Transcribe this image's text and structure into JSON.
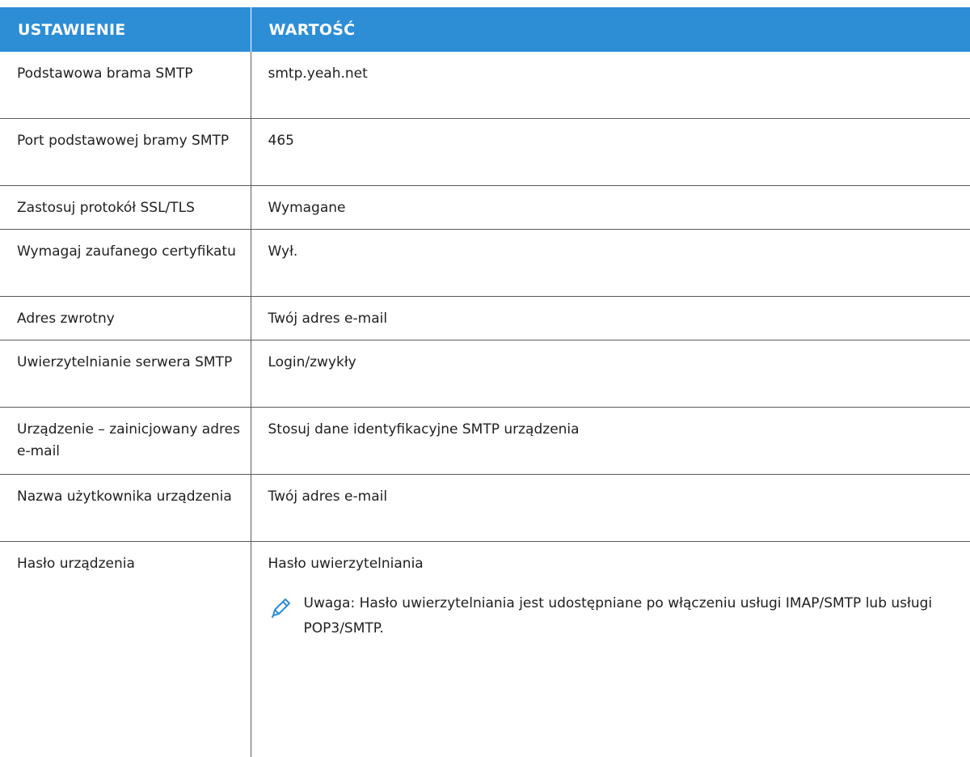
{
  "table": {
    "headers": [
      "USTAWIENIE",
      "WARTOŚĆ"
    ],
    "rows": [
      {
        "setting": "Podstawowa brama SMTP",
        "value": "smtp.yeah.net"
      },
      {
        "setting": "Port podstawowej bramy SMTP",
        "value": "465"
      },
      {
        "setting": "Zastosuj protokół SSL/TLS",
        "value": "Wymagane"
      },
      {
        "setting": "Wymagaj zaufanego certyfikatu",
        "value": "Wył."
      },
      {
        "setting": "Adres zwrotny",
        "value": "Twój adres e-mail"
      },
      {
        "setting": "Uwierzytelnianie serwera SMTP",
        "value": "Login/zwykły"
      },
      {
        "setting": "Urządzenie – zainicjowany adres e-mail",
        "value": "Stosuj dane identyfikacyjne SMTP urządzenia"
      },
      {
        "setting": "Nazwa użytkownika urządzenia",
        "value": "Twój adres e-mail"
      },
      {
        "setting": "Hasło urządzenia",
        "value": "Hasło uwierzytelniania",
        "note": "Uwaga: Hasło uwierzytelniania jest udostępniane po włączeniu usługi IMAP/SMTP lub usługi POP3/SMTP."
      }
    ]
  },
  "colors": {
    "header_bg": "#2d8ed6",
    "header_text": "#ffffff",
    "border": "#5a5a5a",
    "note_icon": "#2d8ed6"
  },
  "icons": {
    "note": "pencil-icon"
  }
}
